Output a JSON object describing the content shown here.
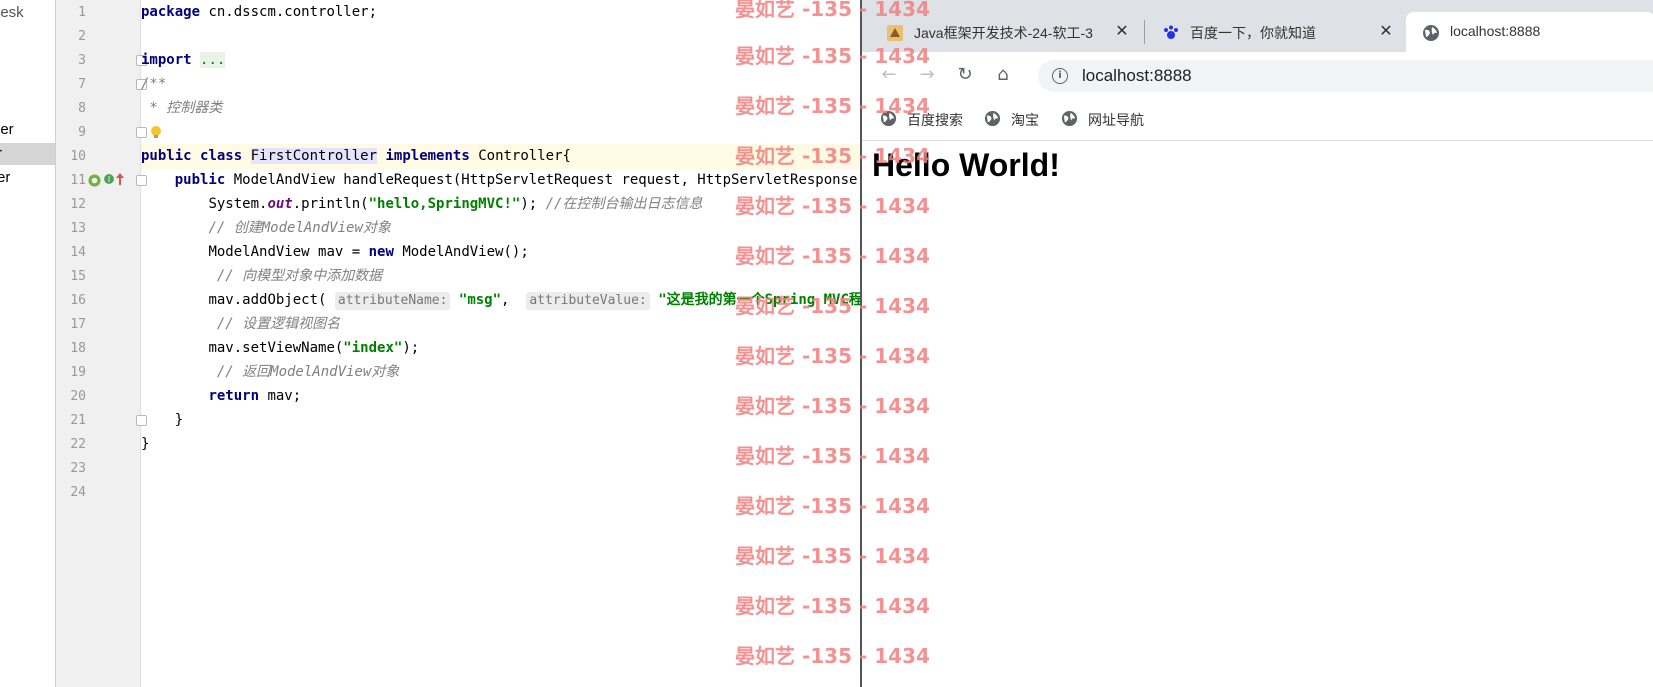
{
  "ide": {
    "project_path": "or\\Desk",
    "project_items": [
      "ler",
      "r",
      "er"
    ],
    "line_numbers": [
      "1",
      "2",
      "3",
      "7",
      "8",
      "9",
      "10",
      "11",
      "12",
      "13",
      "14",
      "15",
      "16",
      "17",
      "18",
      "19",
      "20",
      "21",
      "22",
      "23",
      "24"
    ],
    "code": {
      "l1_kw": "package",
      "l1_rest": " cn.dsscm.controller;",
      "l3_kw": "import",
      "l3_rest": "...",
      "l7": "/**",
      "l8": " * 控制器类",
      "l10_kw1": "public",
      "l10_kw2": "class",
      "l10_cls": "FirstController",
      "l10_kw3": "implements",
      "l10_rest": " Controller{",
      "l11_kw": "public",
      "l11_rest": " ModelAndView handleRequest(HttpServletRequest request, HttpServletResponse response) throws Exception {",
      "l12_a": "System.",
      "l12_out": "out",
      "l12_b": ".println(",
      "l12_str": "\"hello,SpringMVC!\"",
      "l12_c": "); ",
      "l12_cmt": "//在控制台输出日志信息",
      "l13_cmt": "// 创建ModelAndView对象",
      "l14_a": "ModelAndView mav = ",
      "l14_kw": "new",
      "l14_b": " ModelAndView();",
      "l15_cmt": "// 向模型对象中添加数据",
      "l16_a": "mav.addObject( ",
      "l16_hint1": "attributeName:",
      "l16_str1": "\"msg\"",
      "l16_b": ",  ",
      "l16_hint2": "attributeValue:",
      "l16_str2": "\"这是我的第一个Spring MVC程序\"",
      "l16_c": ");",
      "l17_cmt": "// 设置逻辑视图名",
      "l18_a": "mav.setViewName(",
      "l18_str": "\"index\"",
      "l18_b": ");",
      "l19_cmt": "// 返回ModelAndView对象",
      "l20_kw": "return",
      "l20_rest": " mav;",
      "l21": "}",
      "l22": "}"
    }
  },
  "watermark": "晏如艺 -135 - 1434",
  "browser": {
    "tabs": [
      {
        "title": "Java框架开发技术-24-软工-3",
        "icon": "java-favicon"
      },
      {
        "title": "百度一下，你就知道",
        "icon": "baidu-paw-favicon"
      },
      {
        "title": "localhost:8888",
        "icon": "globe-favicon"
      }
    ],
    "close_symbol": "✕",
    "nav": {
      "back": "←",
      "forward": "→",
      "reload": "↻",
      "home": "⌂"
    },
    "address": "localhost:8888",
    "bookmarks": [
      "百度搜索",
      "淘宝",
      "网址导航"
    ],
    "page_heading": "Hello World!"
  },
  "colors": {
    "keyword": "#000080",
    "string": "#008000",
    "comment": "#808080",
    "watermark": "#f08080",
    "current_line": "#fffae3"
  }
}
